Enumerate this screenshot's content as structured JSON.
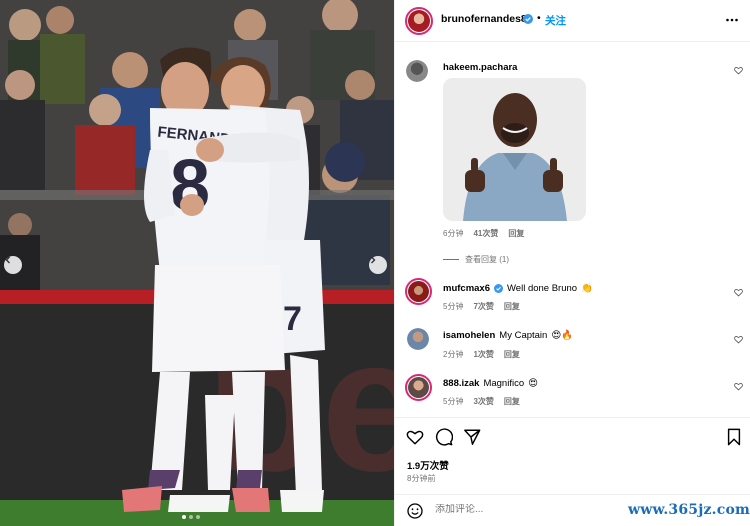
{
  "post": {
    "username": "brunofernandes8",
    "separator": "•",
    "follow_label": "关注",
    "more_icon": "more-horizontal-icon"
  },
  "photo": {
    "jersey_name": "FERNANDES",
    "jersey_number_front": "8",
    "jersey_number_back": "7",
    "board_text": "bet",
    "carousel_total": 3,
    "carousel_active": 1
  },
  "comments": [
    {
      "username": "hakeem.pachara",
      "text": "",
      "time": "6分钟",
      "likes": "41次赞",
      "reply": "回复",
      "view_replies": "查看回复 (1)"
    },
    {
      "username": "mufcmax6",
      "verified": true,
      "text": "Well done Bruno",
      "emoji": "👏",
      "time": "5分钟",
      "likes": "7次赞",
      "reply": "回复"
    },
    {
      "username": "isamohelen",
      "text": "My Captain",
      "emoji": "😍🔥",
      "time": "2分钟",
      "likes": "1次赞",
      "reply": "回复"
    },
    {
      "username": "888.izak",
      "text": "Magnifico",
      "emoji": "😍",
      "time": "5分钟",
      "likes": "3次赞",
      "reply": "回复"
    }
  ],
  "footer": {
    "likes": "1.9万次赞",
    "time_ago": "8分钟前",
    "add_comment_placeholder": "添加评论..."
  },
  "watermark": "www.365jz.com",
  "colors": {
    "accent": "#0095f6",
    "verified": "#3897f0",
    "muted": "#737373",
    "ring": "#d62976"
  }
}
